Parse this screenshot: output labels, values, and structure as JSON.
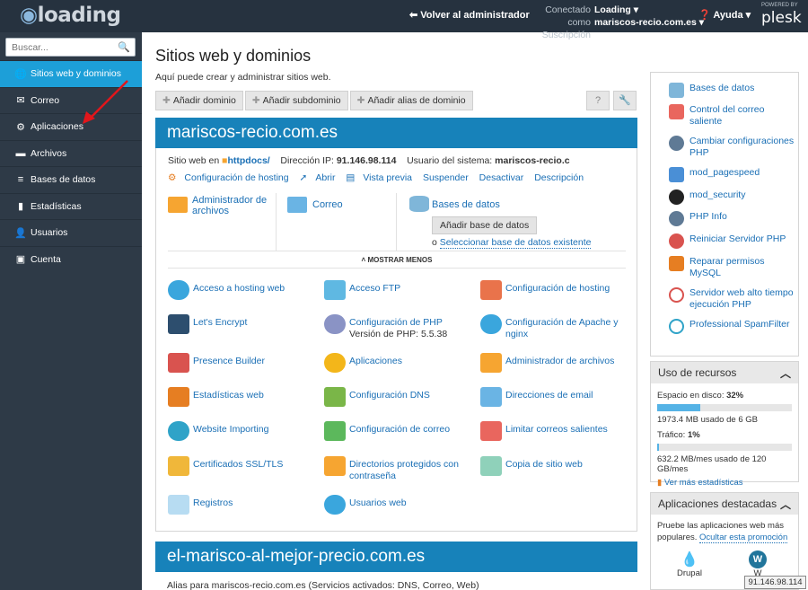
{
  "header": {
    "logo_text": "loading",
    "back_label": "Volver al administrador",
    "connected_label": "Conectado como",
    "connected_value": "Loading",
    "subscription_label": "Suscripción",
    "subscription_value": "mariscos-recio.com.es",
    "help_label": "Ayuda",
    "powered_by": "POWERED BY",
    "brand": "plesk"
  },
  "search": {
    "placeholder": "Buscar..."
  },
  "nav": [
    {
      "label": "Sitios web y dominios"
    },
    {
      "label": "Correo"
    },
    {
      "label": "Aplicaciones"
    },
    {
      "label": "Archivos"
    },
    {
      "label": "Bases de datos"
    },
    {
      "label": "Estadísticas"
    },
    {
      "label": "Usuarios"
    },
    {
      "label": "Cuenta"
    }
  ],
  "page": {
    "title": "Sitios web y dominios",
    "description": "Aquí puede crear y administrar sitios web."
  },
  "toolbar": {
    "add_domain": "Añadir dominio",
    "add_subdomain": "Añadir subdominio",
    "add_alias": "Añadir alias de dominio"
  },
  "domain": {
    "name": "mariscos-recio.com.es",
    "site_label": "Sitio web en",
    "site_dir": "httpdocs/",
    "ip_label": "Dirección IP:",
    "ip": "91.146.98.114",
    "user_label": "Usuario del sistema:",
    "user": "mariscos-recio.c",
    "actions": [
      "Configuración de hosting",
      "Abrir",
      "Vista previa",
      "Suspender",
      "Desactivar",
      "Descripción"
    ],
    "file_manager": "Administrador de archivos",
    "mail": "Correo",
    "databases": "Bases de datos",
    "add_db": "Añadir base de datos",
    "select_prefix": "o",
    "select_db": "Seleccionar base de datos existente",
    "show_less": "MOSTRAR MENOS",
    "tools": [
      {
        "label": "Acceso a hosting web"
      },
      {
        "label": "Acceso FTP"
      },
      {
        "label": "Configuración de hosting"
      },
      {
        "label": "Let's Encrypt"
      },
      {
        "label": "Configuración de PHP",
        "sub": "Versión de PHP: 5.5.38"
      },
      {
        "label": "Configuración de Apache y nginx"
      },
      {
        "label": "Presence Builder"
      },
      {
        "label": "Aplicaciones"
      },
      {
        "label": "Administrador de archivos"
      },
      {
        "label": "Estadísticas web"
      },
      {
        "label": "Configuración DNS"
      },
      {
        "label": "Direcciones de email"
      },
      {
        "label": "Website Importing"
      },
      {
        "label": "Configuración de correo"
      },
      {
        "label": "Limitar correos salientes"
      },
      {
        "label": "Certificados SSL/TLS"
      },
      {
        "label": "Directorios protegidos con contraseña"
      },
      {
        "label": "Copia de sitio web"
      },
      {
        "label": "Registros"
      },
      {
        "label": "Usuarios web"
      }
    ]
  },
  "domain2": {
    "name": "el-marisco-al-mejor-precio.com.es",
    "sub": "Alias para mariscos-recio.com.es (Servicios activados: DNS, Correo, Web)"
  },
  "right_links": [
    "Bases de datos",
    "Control del correo saliente",
    "Cambiar configuraciones PHP",
    "mod_pagespeed",
    "mod_security",
    "PHP Info",
    "Reiniciar Servidor PHP",
    "Reparar permisos MySQL",
    "Servidor web alto tiempo ejecución PHP",
    "Professional SpamFilter"
  ],
  "usage": {
    "title": "Uso de recursos",
    "disk_label": "Espacio en disco:",
    "disk_pct": "32%",
    "disk_fraction": 0.32,
    "disk_detail": "1973.4 MB usado de 6 GB",
    "traffic_label": "Tráfico:",
    "traffic_pct": "1%",
    "traffic_fraction": 0.01,
    "traffic_detail": "632.2 MB/mes usado de 120 GB/mes",
    "more": "Ver más estadísticas"
  },
  "apps": {
    "title": "Aplicaciones destacadas",
    "text": "Pruebe las aplicaciones web más populares.",
    "hide": "Ocultar esta promoción",
    "app1": "Drupal",
    "app2": "W"
  },
  "ip_badge": "91.146.98.114",
  "colors": {
    "accent": "#1d9fd8",
    "domain_header": "#1782ba",
    "sidebar": "#2e3a47",
    "topbar": "#26323f"
  }
}
